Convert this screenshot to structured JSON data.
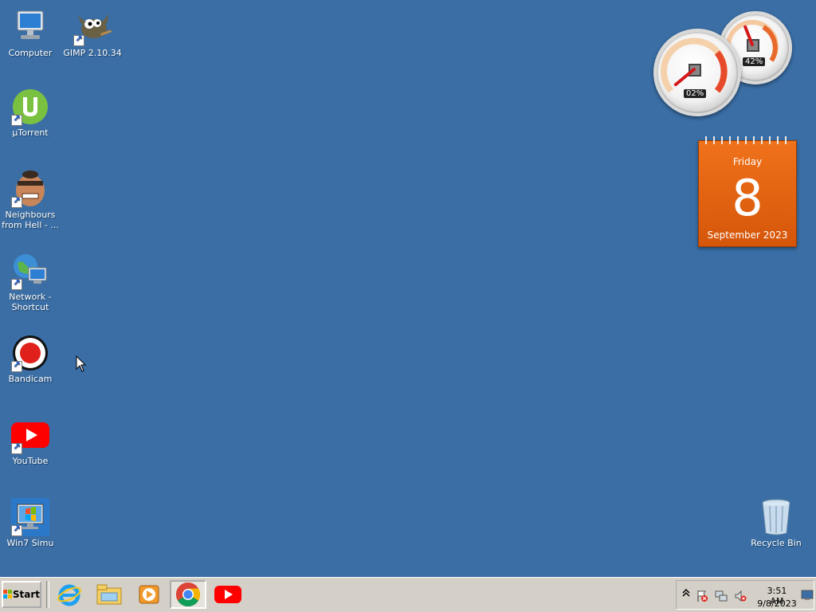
{
  "desktop_icons": [
    {
      "label": "Computer",
      "icon": "computer-icon"
    },
    {
      "label": "GIMP 2.10.34",
      "icon": "gimp-icon"
    },
    {
      "label": "µTorrent",
      "icon": "utorrent-icon"
    },
    {
      "label": "Neighbours from Hell - ...",
      "icon": "neighbours-from-hell-icon"
    },
    {
      "label": "Network - Shortcut",
      "icon": "network-icon"
    },
    {
      "label": "Bandicam",
      "icon": "bandicam-icon"
    },
    {
      "label": "YouTube",
      "icon": "youtube-icon"
    },
    {
      "label": "Win7 Simu",
      "icon": "win7-simu-icon"
    },
    {
      "label": "Recycle Bin",
      "icon": "recycle-bin-icon"
    }
  ],
  "gadgets": {
    "cpu_meter": {
      "cpu_readout": "02%",
      "memory_readout": "42%",
      "cpu_fraction": 0.02,
      "memory_fraction": 0.42
    },
    "calendar": {
      "day": "Friday",
      "date": "8",
      "month_year": "September 2023"
    }
  },
  "taskbar": {
    "start_label": "Start",
    "pinned": [
      {
        "name": "internet-explorer-icon"
      },
      {
        "name": "windows-explorer-icon"
      },
      {
        "name": "media-player-icon"
      },
      {
        "name": "chrome-icon"
      },
      {
        "name": "youtube-icon"
      }
    ],
    "tray": {
      "icons": [
        "show-hidden-icons-icon",
        "action-center-flag-icon",
        "network-icon",
        "volume-muted-icon"
      ],
      "time": "3:51 AM",
      "date": "9/8/2023"
    }
  },
  "colors": {
    "desktop": "#3a6ea5",
    "taskbar": "#d4d0c8",
    "calendar": "#e8640f"
  }
}
